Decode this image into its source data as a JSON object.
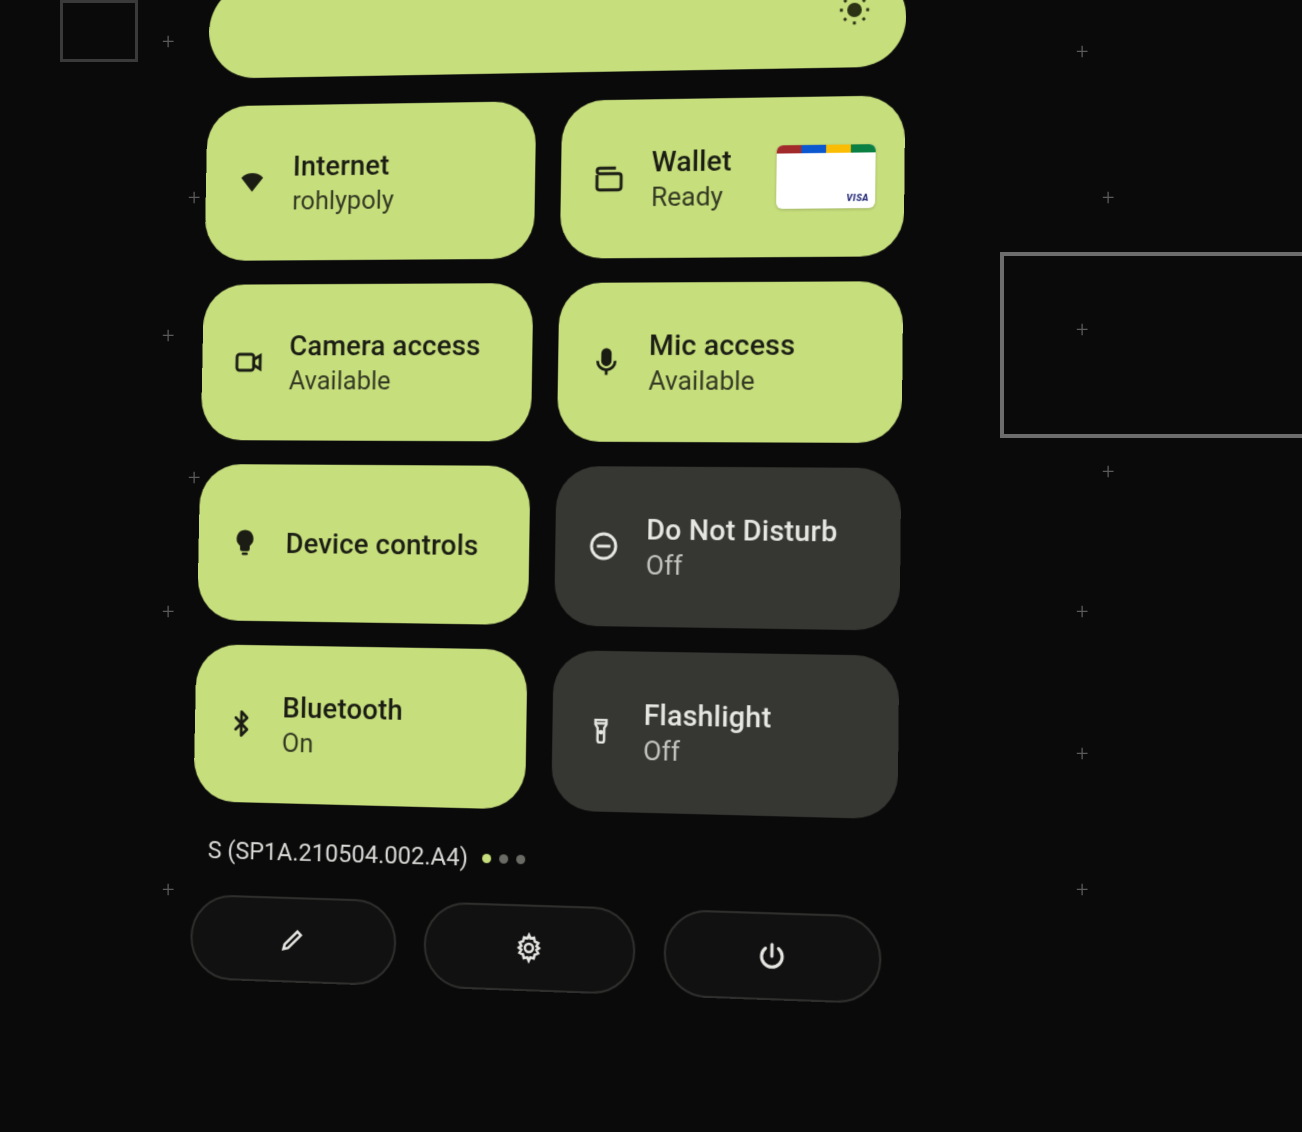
{
  "colors": {
    "tile_on": "#c6de7c",
    "tile_off": "#363632",
    "bg": "#0a0a0a"
  },
  "brightness": {
    "icon": "brightness-icon"
  },
  "tiles": [
    {
      "id": "internet",
      "title": "Internet",
      "sub": "rohlypoly",
      "state": "on",
      "icon": "wifi-icon"
    },
    {
      "id": "wallet",
      "title": "Wallet",
      "sub": "Ready",
      "state": "on",
      "icon": "wallet-icon",
      "card": {
        "brand": "VISA",
        "stripe": [
          "#a22a2a",
          "#0b57d0",
          "#fbbc04",
          "#0b8043"
        ]
      }
    },
    {
      "id": "camera-access",
      "title": "Camera access",
      "sub": "Available",
      "state": "on",
      "icon": "camera-icon"
    },
    {
      "id": "mic-access",
      "title": "Mic access",
      "sub": "Available",
      "state": "on",
      "icon": "mic-icon"
    },
    {
      "id": "device-controls",
      "title": "Device controls",
      "sub": "",
      "state": "on",
      "icon": "bulb-icon"
    },
    {
      "id": "dnd",
      "title": "Do Not Disturb",
      "sub": "Off",
      "state": "off",
      "icon": "dnd-icon"
    },
    {
      "id": "bluetooth",
      "title": "Bluetooth",
      "sub": "On",
      "state": "on",
      "icon": "bluetooth-icon"
    },
    {
      "id": "flashlight",
      "title": "Flashlight",
      "sub": "Off",
      "state": "off",
      "icon": "flashlight-icon"
    }
  ],
  "build": {
    "label": "S (SP1A.210504.002.A4)",
    "page_dots": [
      "#c6de7c",
      "#6b6b66",
      "#6b6b66"
    ]
  },
  "footer": [
    {
      "id": "edit",
      "icon": "pencil-icon"
    },
    {
      "id": "settings",
      "icon": "gear-icon"
    },
    {
      "id": "power",
      "icon": "power-icon"
    }
  ]
}
